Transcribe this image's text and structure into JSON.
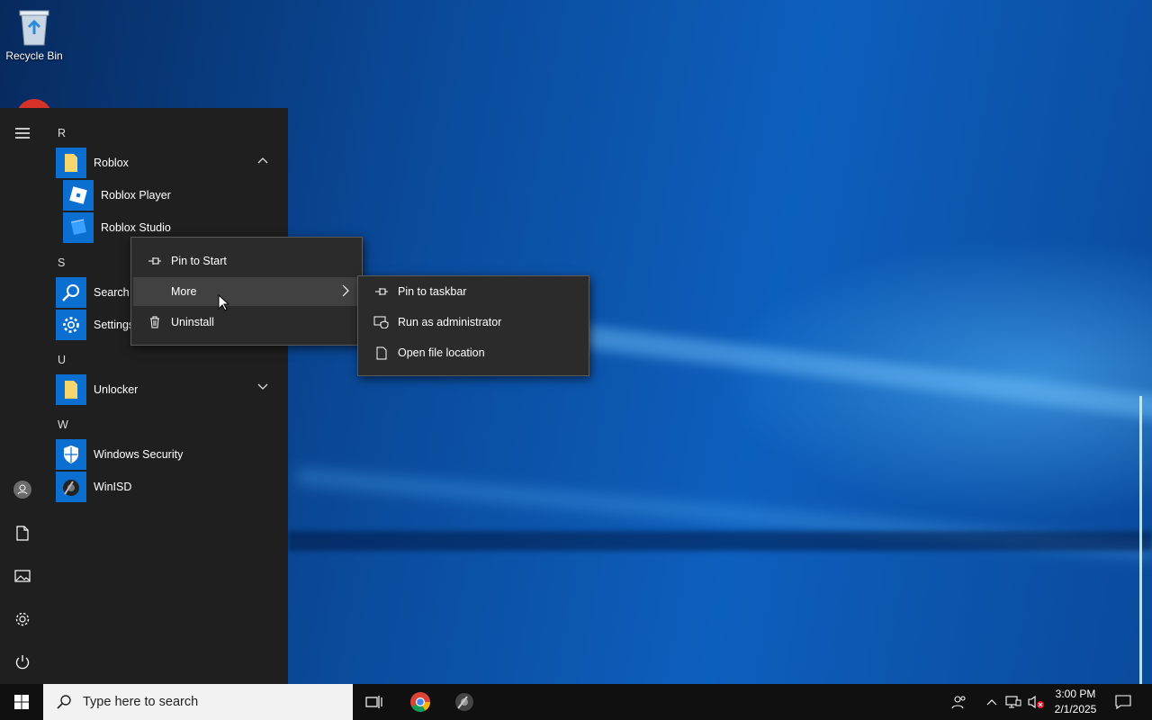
{
  "desktop": {
    "icons": [
      {
        "label": "Recycle Bin",
        "icon": "recycle-bin-icon"
      }
    ]
  },
  "start_menu": {
    "rail": [
      "hamburger-icon",
      "user-icon",
      "document-icon",
      "pictures-icon",
      "settings-icon",
      "power-icon"
    ],
    "sections": [
      {
        "letter": "R"
      },
      {
        "letter": "S"
      },
      {
        "letter": "U"
      },
      {
        "letter": "W"
      }
    ],
    "apps": {
      "roblox": "Roblox",
      "roblox_player": "Roblox Player",
      "roblox_studio": "Roblox Studio",
      "search": "Search",
      "settings": "Settings",
      "unlocker": "Unlocker",
      "windows_security": "Windows Security",
      "winisd": "WinISD"
    }
  },
  "context_menu": {
    "items": [
      {
        "label": "Pin to Start",
        "icon": "pin-icon"
      },
      {
        "label": "More",
        "icon": "",
        "highlighted": true
      },
      {
        "label": "Uninstall",
        "icon": "trash-icon"
      }
    ]
  },
  "submenu": {
    "items": [
      {
        "label": "Pin to taskbar",
        "icon": "pin-icon"
      },
      {
        "label": "Run as administrator",
        "icon": "shield-window-icon"
      },
      {
        "label": "Open file location",
        "icon": "file-icon"
      }
    ]
  },
  "taskbar": {
    "search_placeholder": "Type here to search",
    "apps": [
      "task-view-icon",
      "chrome-icon",
      "winisd-icon"
    ],
    "tray": [
      "people-icon",
      "chevron-up-icon",
      "network-icon",
      "volume-muted-icon",
      "notification-icon"
    ],
    "time": "3:00 PM",
    "date": "2/1/2025"
  },
  "colors": {
    "start_bg": "#1f1f1f",
    "menu_bg": "#2b2b2b",
    "menu_highlight": "#414141",
    "tile_blue": "#0b6fd1",
    "taskbar_bg": "#101010"
  }
}
